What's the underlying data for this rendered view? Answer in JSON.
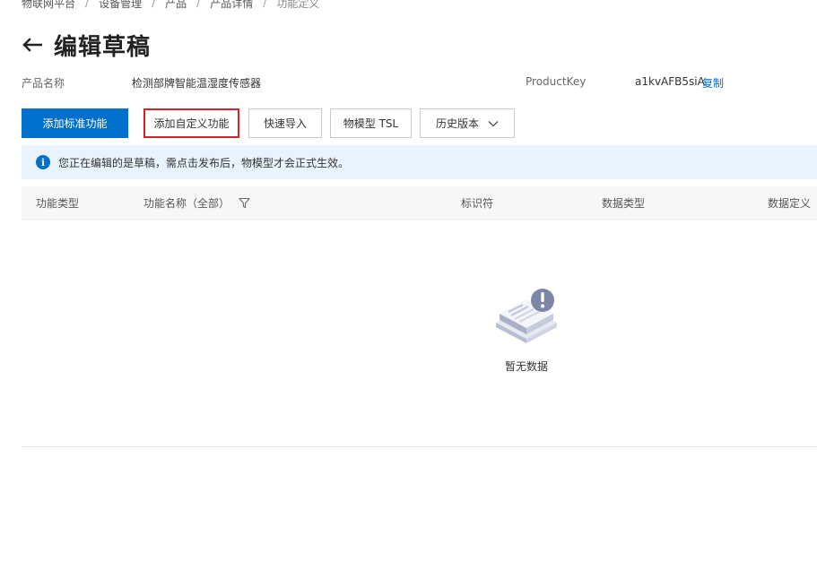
{
  "breadcrumb": [
    "物联网平台",
    "设备管理",
    "产品",
    "产品详情",
    "功能定义"
  ],
  "page": {
    "title": "编辑草稿"
  },
  "product": {
    "name_label": "产品名称",
    "name_value": "检测部牌智能温湿度传感器",
    "key_label": "ProductKey",
    "key_value": "a1kvAFB5siA",
    "copy_label": "复制"
  },
  "toolbar": {
    "add_standard": "添加标准功能",
    "add_custom": "添加自定义功能",
    "quick_import": "快速导入",
    "tsl": "物模型 TSL",
    "history": "历史版本"
  },
  "notice": {
    "icon": "i",
    "text": "您正在编辑的是草稿，需点击发布后，物模型才会正式生效。"
  },
  "table": {
    "columns": [
      "功能类型",
      "功能名称（全部）",
      "标识符",
      "数据类型",
      "数据定义"
    ],
    "empty_text": "暂无数据"
  },
  "colors": {
    "primary": "#0070cc",
    "highlight_border": "#d9202b",
    "notice_bg": "#e8f3fd"
  }
}
